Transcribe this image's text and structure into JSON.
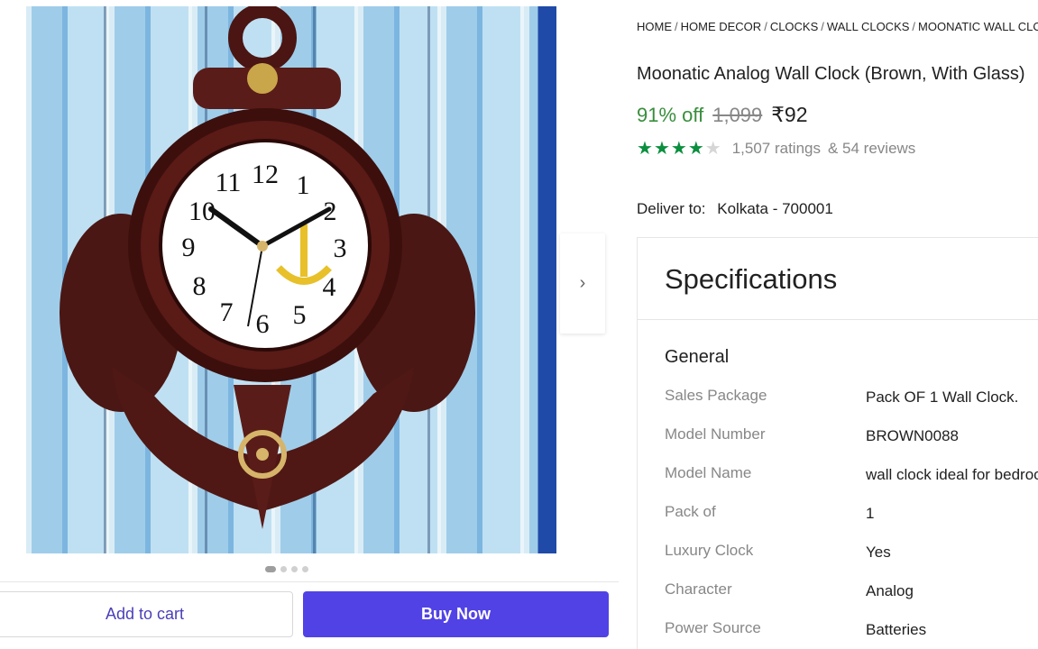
{
  "breadcrumb": [
    "HOME",
    "HOME DECOR",
    "CLOCKS",
    "WALL CLOCKS",
    "MOONATIC WALL CLOCKS"
  ],
  "product": {
    "title": "Moonatic Analog Wall Clock (Brown, With Glass)",
    "discount": "91% off",
    "mrp": "1,099",
    "price": "₹92",
    "rating_stars": 4,
    "ratings": "1,507 ratings",
    "reviews": "& 54 reviews"
  },
  "delivery": {
    "label": "Deliver to:",
    "location": "Kolkata - 700001"
  },
  "gallery": {
    "next_icon": "chevron-right-icon",
    "dots_count": 4,
    "active_dot": 0,
    "clock_numerals": [
      "12",
      "1",
      "2",
      "3",
      "4",
      "5",
      "6",
      "7",
      "8",
      "9",
      "10",
      "11"
    ]
  },
  "actions": {
    "add_to_cart": "Add to cart",
    "buy_now": "Buy Now"
  },
  "specifications": {
    "title": "Specifications",
    "group": "General",
    "rows": [
      {
        "key": "Sales Package",
        "value": "Pack OF 1 Wall Clock."
      },
      {
        "key": "Model Number",
        "value": "BROWN0088"
      },
      {
        "key": "Model Name",
        "value": "wall clock ideal for bedroom"
      },
      {
        "key": "Pack of",
        "value": "1"
      },
      {
        "key": "Luxury Clock",
        "value": "Yes"
      },
      {
        "key": "Character",
        "value": "Analog"
      },
      {
        "key": "Power Source",
        "value": "Batteries"
      }
    ]
  },
  "colors": {
    "accent": "#5142e6",
    "discount_green": "#388e3c",
    "star_green": "#0a8f3d",
    "muted": "#878787"
  }
}
